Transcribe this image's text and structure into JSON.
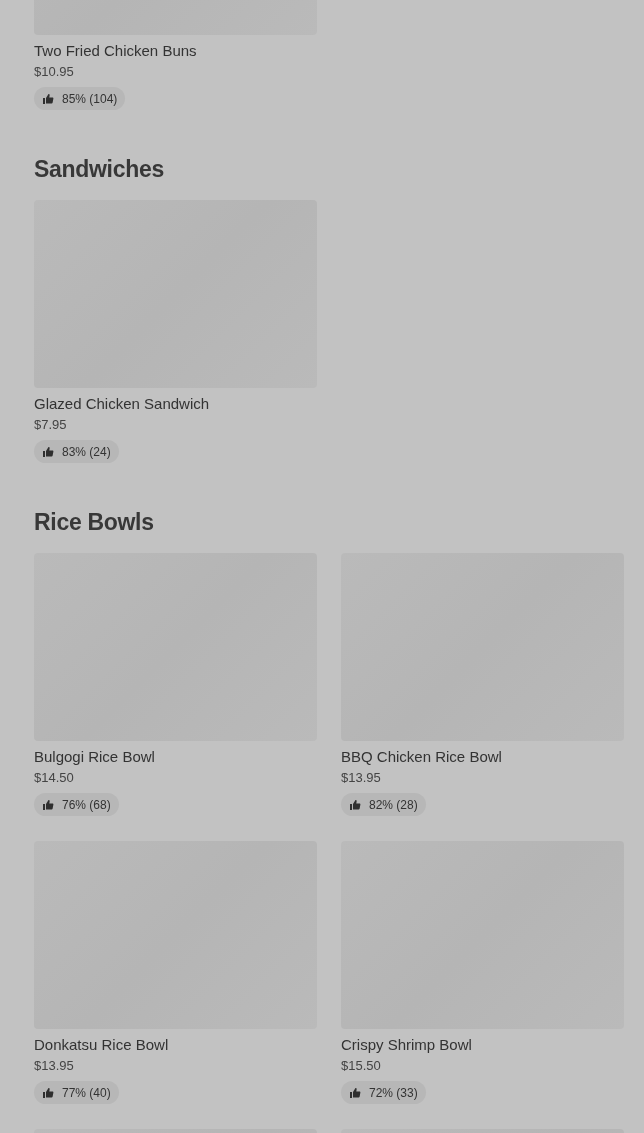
{
  "sections": [
    {
      "items": [
        {
          "kind": "item",
          "name": "Two Fried Chicken Buns",
          "price": "$10.95",
          "rating": "85% (104)"
        }
      ]
    },
    {
      "title": "Sandwiches",
      "items": [
        {
          "kind": "item",
          "name": "Glazed Chicken Sandwich",
          "price": "$7.95",
          "rating": "83% (24)"
        }
      ]
    },
    {
      "title": "Rice Bowls",
      "items": [
        {
          "kind": "item",
          "name": "Bulgogi Rice Bowl",
          "price": "$14.50",
          "rating": "76% (68)"
        },
        {
          "kind": "item",
          "name": "BBQ Chicken Rice Bowl",
          "price": "$13.95",
          "rating": "82% (28)"
        },
        {
          "kind": "item",
          "name": "Donkatsu Rice Bowl",
          "price": "$13.95",
          "rating": "77% (40)"
        },
        {
          "kind": "item",
          "name": "Crispy Shrimp Bowl",
          "price": "$15.50",
          "rating": "72% (33)"
        },
        {
          "kind": "image_only"
        },
        {
          "kind": "image_only"
        }
      ]
    }
  ]
}
